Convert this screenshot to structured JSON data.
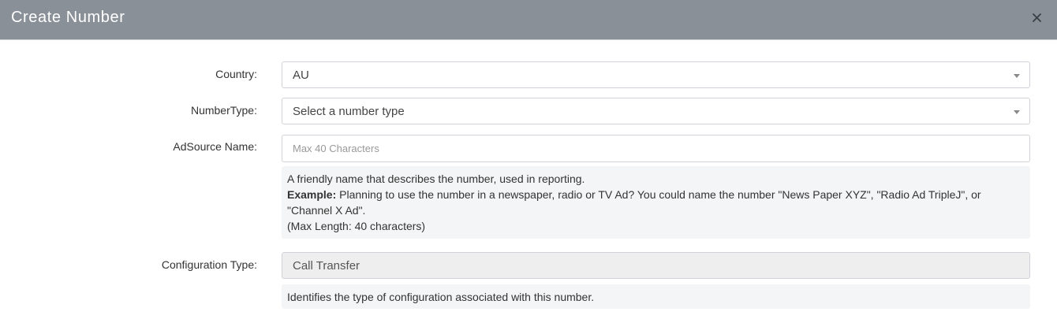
{
  "modal": {
    "title": "Create Number",
    "close_label": "×"
  },
  "form": {
    "country": {
      "label": "Country:",
      "value": "AU"
    },
    "number_type": {
      "label": "NumberType:",
      "value": "Select a number type"
    },
    "adsource_name": {
      "label": "AdSource Name:",
      "value": "",
      "placeholder": "Max 40 Characters",
      "help": {
        "line1": "A friendly name that describes the number, used in reporting.",
        "example_label": "Example:",
        "example_text": " Planning to use the number in a newspaper, radio or TV Ad? You could name the number \"News Paper XYZ\", \"Radio Ad TripleJ\", or \"Channel X Ad\".",
        "line3": "(Max Length: 40 characters)"
      }
    },
    "configuration_type": {
      "label": "Configuration Type:",
      "value": "Call Transfer",
      "help": "Identifies the type of configuration associated with this number."
    }
  },
  "icons": {
    "close": "close-icon",
    "dropdown": "chevron-down-icon"
  }
}
